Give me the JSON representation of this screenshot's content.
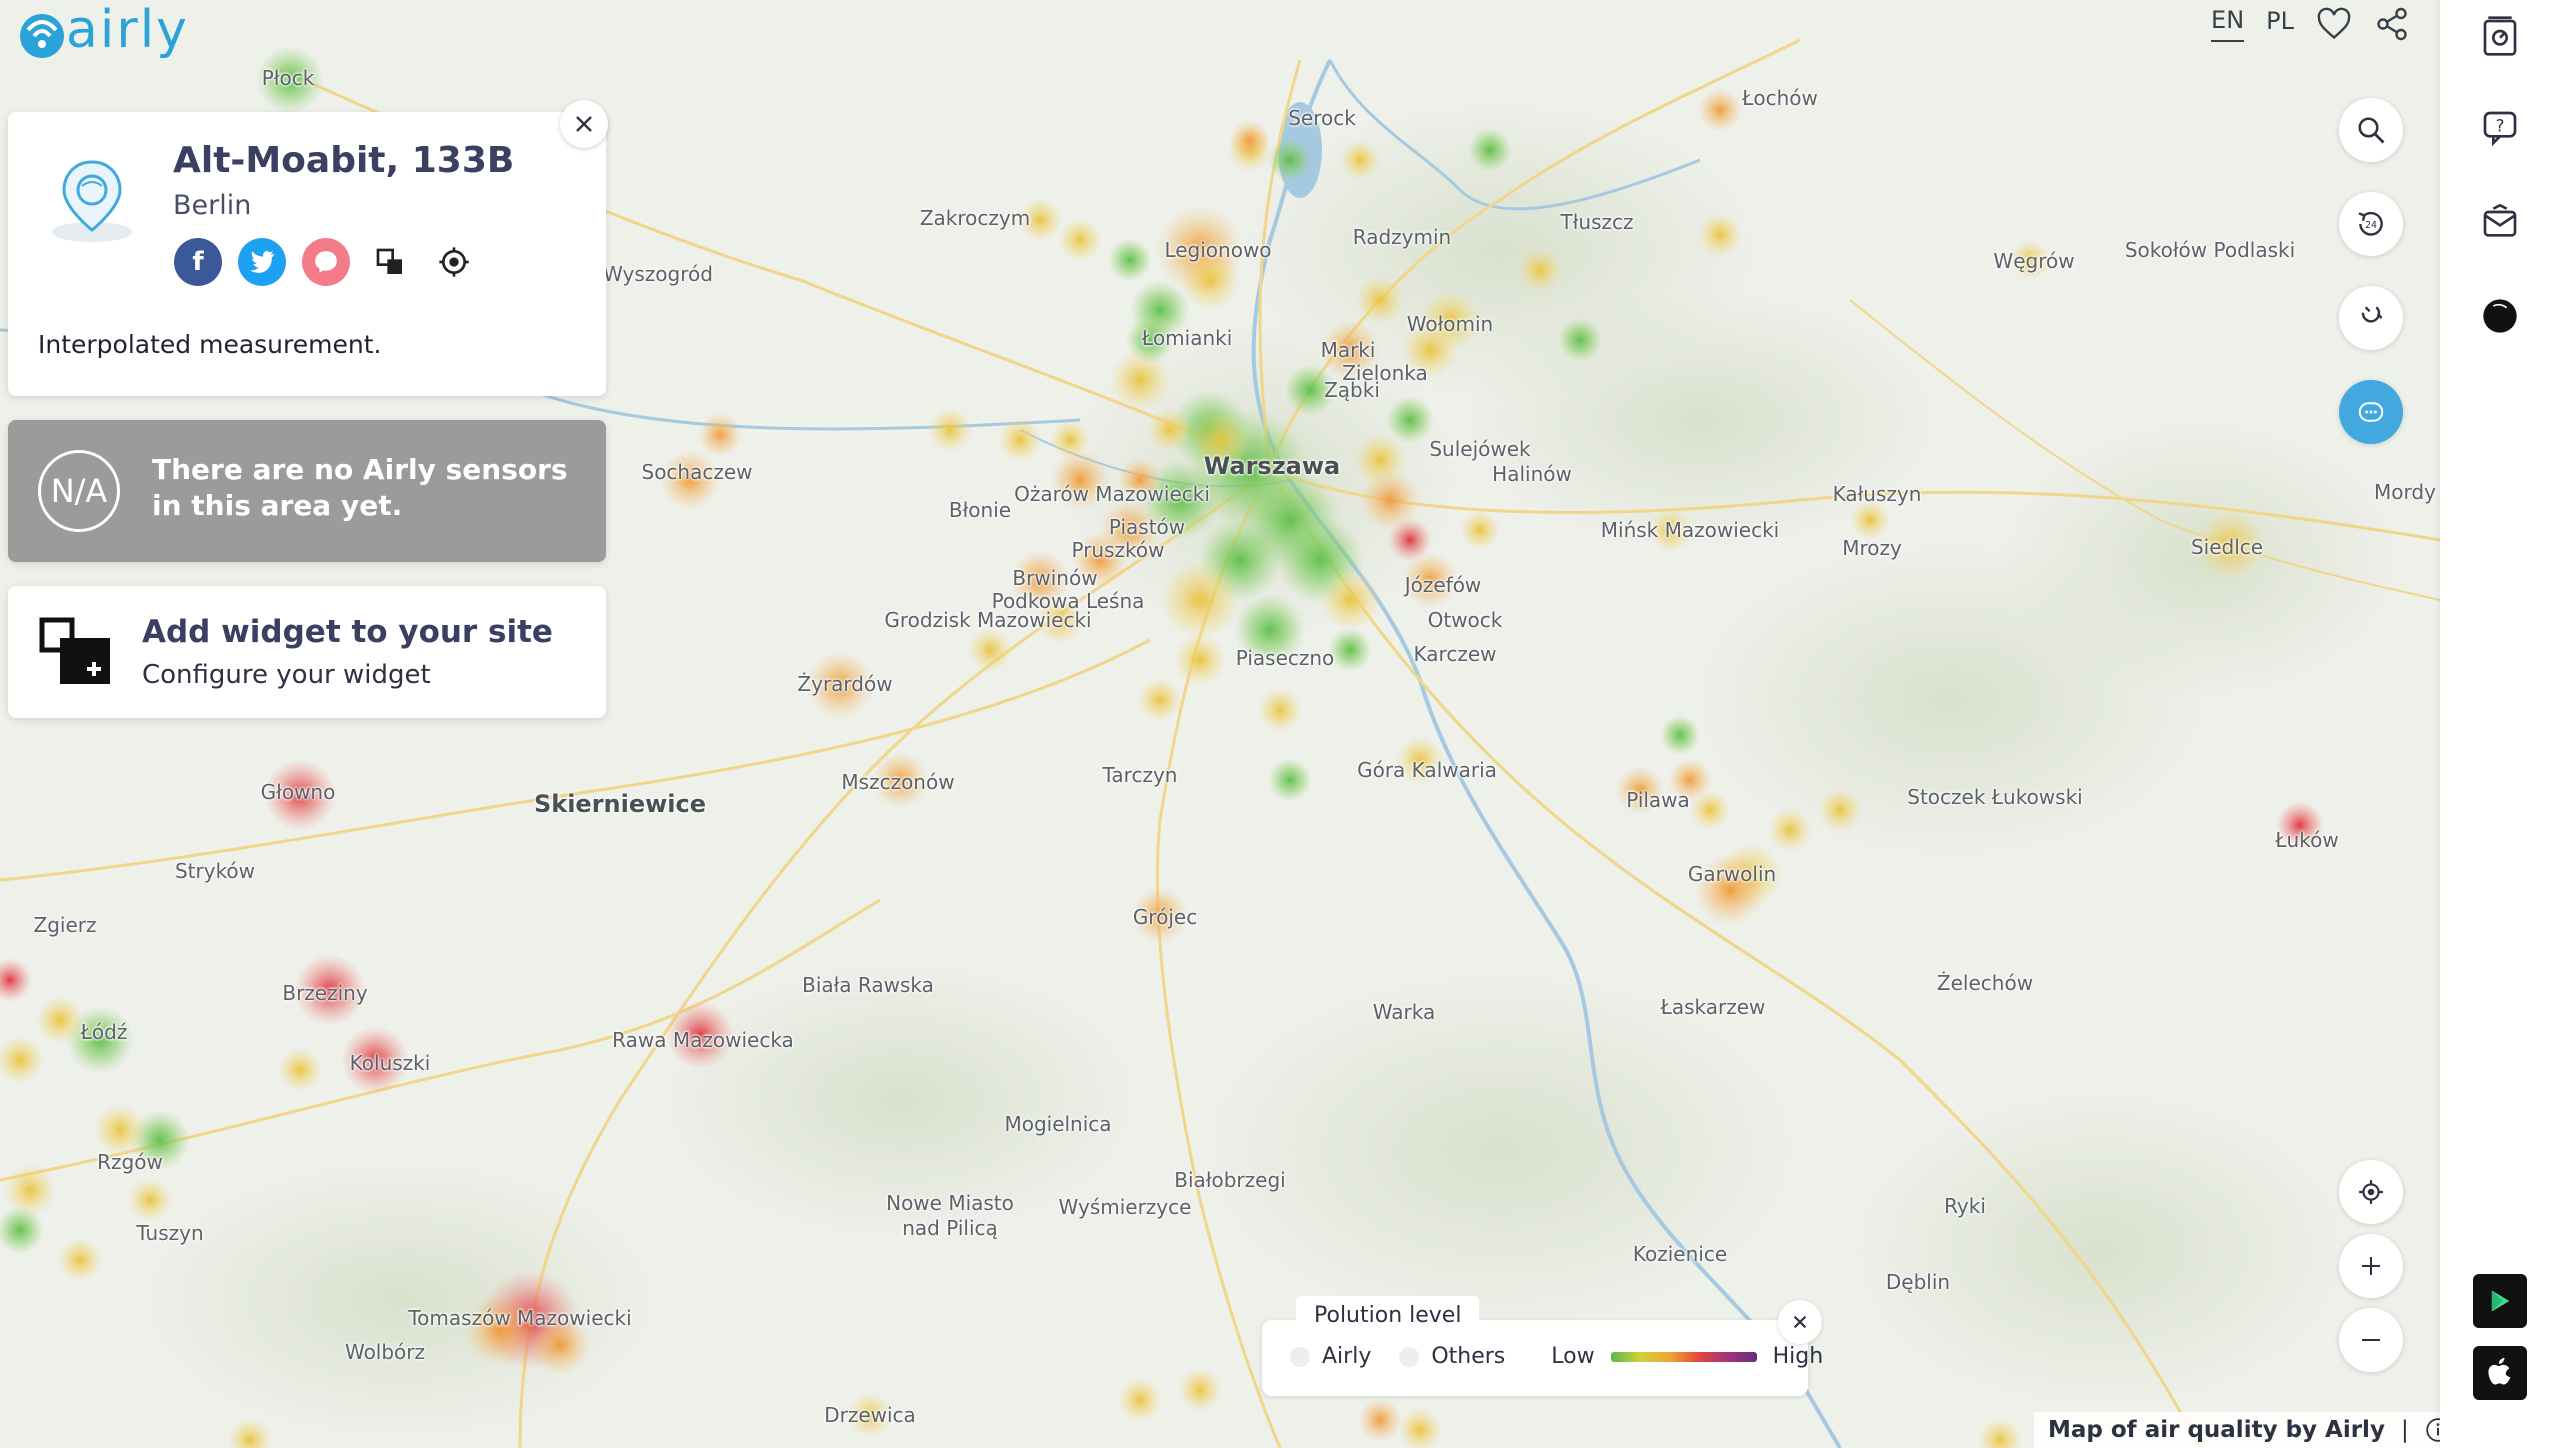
{
  "app": {
    "logo_text": "airly"
  },
  "header": {
    "languages": [
      {
        "label": "EN",
        "active": true
      },
      {
        "label": "PL",
        "active": false
      }
    ]
  },
  "location_card": {
    "title": "Alt-Moabit, 133B",
    "city": "Berlin",
    "note": "Interpolated measurement.",
    "social": [
      "facebook-icon",
      "twitter-icon",
      "messenger-icon",
      "widget-icon",
      "locate-icon"
    ]
  },
  "no_sensors": {
    "badge": "N/A",
    "message": "There are no Airly sensors in this area yet."
  },
  "widget_card": {
    "title": "Add widget to your site",
    "subtitle": "Configure your widget"
  },
  "legend": {
    "title": "Polution level",
    "airly_label": "Airly",
    "others_label": "Others",
    "low_label": "Low",
    "high_label": "High"
  },
  "attribution": {
    "text": "Map of air quality by Airly",
    "separator": "|"
  },
  "map": {
    "places": [
      {
        "name": "Płock"
      },
      {
        "name": "Serock"
      },
      {
        "name": "Łochów"
      },
      {
        "name": "Zakroczym"
      },
      {
        "name": "Legionowo"
      },
      {
        "name": "Radzymin"
      },
      {
        "name": "Tłuszcz"
      },
      {
        "name": "Węgrów"
      },
      {
        "name": "Sokołów Podlaski"
      },
      {
        "name": "Wyszogród"
      },
      {
        "name": "Łomianki"
      },
      {
        "name": "Marki"
      },
      {
        "name": "Wołomin"
      },
      {
        "name": "Zielonka"
      },
      {
        "name": "Ząbki"
      },
      {
        "name": "Sochaczew"
      },
      {
        "name": "Warszawa",
        "big": true
      },
      {
        "name": "Sulejówek"
      },
      {
        "name": "Halinów"
      },
      {
        "name": "Kałuszyn"
      },
      {
        "name": "Siedlce"
      },
      {
        "name": "Mordy"
      },
      {
        "name": "Błonie"
      },
      {
        "name": "Ożarów Mazowiecki"
      },
      {
        "name": "Piastów"
      },
      {
        "name": "Pruszków"
      },
      {
        "name": "Mińsk Mazowiecki"
      },
      {
        "name": "Mrozy"
      },
      {
        "name": "Brwinów"
      },
      {
        "name": "Józefów"
      },
      {
        "name": "Podkowa Leśna"
      },
      {
        "name": "Grodzisk Mazowiecki"
      },
      {
        "name": "Otwock"
      },
      {
        "name": "Karczew"
      },
      {
        "name": "Piaseczno"
      },
      {
        "name": "Żyrardów"
      },
      {
        "name": "Tarczyn"
      },
      {
        "name": "Góra Kalwaria"
      },
      {
        "name": "Pilawa"
      },
      {
        "name": "Stoczek Łukowski"
      },
      {
        "name": "Łuków"
      },
      {
        "name": "Mszczonów"
      },
      {
        "name": "Skierniewice",
        "big": true
      },
      {
        "name": "Głowno"
      },
      {
        "name": "Garwolin"
      },
      {
        "name": "Stryków"
      },
      {
        "name": "Zgierz"
      },
      {
        "name": "Grójec"
      },
      {
        "name": "Brzeziny"
      },
      {
        "name": "Biała Rawska"
      },
      {
        "name": "Żelechów"
      },
      {
        "name": "Łódź"
      },
      {
        "name": "Rawa Mazowiecka"
      },
      {
        "name": "Koluszki"
      },
      {
        "name": "Warka"
      },
      {
        "name": "Łaskarzew"
      },
      {
        "name": "Mogielnica"
      },
      {
        "name": "Rzgów"
      },
      {
        "name": "Białobrzegi"
      },
      {
        "name": "Nowe Miasto"
      },
      {
        "name": "nad Pilicą"
      },
      {
        "name": "Wyśmierzyce"
      },
      {
        "name": "Ryki"
      },
      {
        "name": "Tuszyn"
      },
      {
        "name": "Kozienice"
      },
      {
        "name": "Dęblin"
      },
      {
        "name": "Tomaszów Mazowiecki"
      },
      {
        "name": "Wolbórz"
      },
      {
        "name": "Drzewica"
      }
    ]
  },
  "colors": {
    "accent": "#43a8de",
    "logo": "#2aa3d8",
    "title": "#3b3f62",
    "na_card": "#9a9b9b",
    "facebook": "#3b5998",
    "twitter": "#1da1f2",
    "messenger": "#f47c8a"
  }
}
